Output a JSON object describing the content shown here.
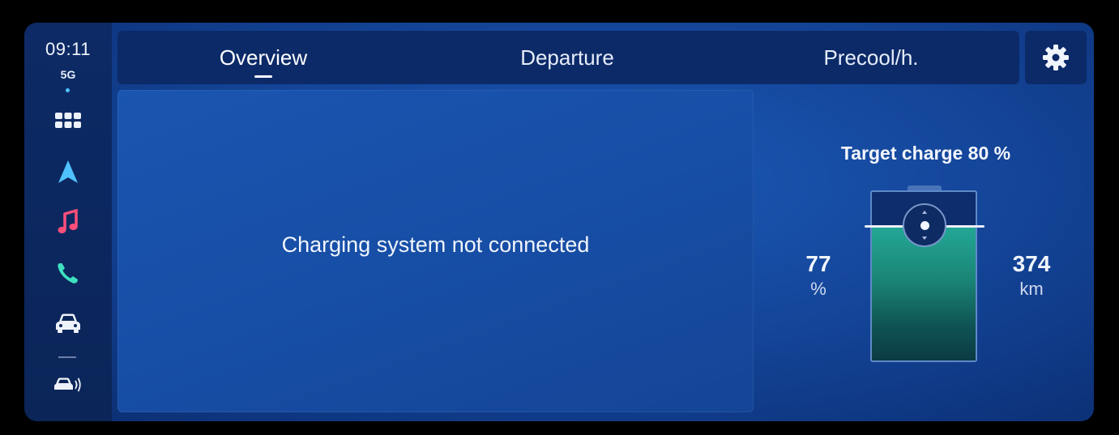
{
  "status_bar": {
    "time": "09:11",
    "network": "5G"
  },
  "sidebar": {
    "items": [
      {
        "icon": "apps-grid-icon"
      },
      {
        "icon": "navigation-arrow-icon"
      },
      {
        "icon": "music-note-icon"
      },
      {
        "icon": "phone-icon"
      },
      {
        "icon": "car-icon"
      },
      {
        "icon": "car-sensor-icon"
      }
    ]
  },
  "tabs": [
    {
      "label": "Overview",
      "active": true
    },
    {
      "label": "Departure",
      "active": false
    },
    {
      "label": "Precool/h.",
      "active": false
    }
  ],
  "settings": {
    "icon": "gear-icon"
  },
  "main": {
    "message": "Charging system not connected"
  },
  "charge": {
    "target_label": "Target charge 80 %",
    "target_percent": 80,
    "state_of_charge": "77",
    "state_of_charge_unit": "%",
    "range": "374",
    "range_unit": "km"
  },
  "colors": {
    "background": "#14469a",
    "panel": "#174ea6",
    "battery_fill": "#1a8577",
    "accent_nav": "#4fc3ff",
    "music": "#ff4f7a",
    "phone": "#3ee0c0"
  }
}
